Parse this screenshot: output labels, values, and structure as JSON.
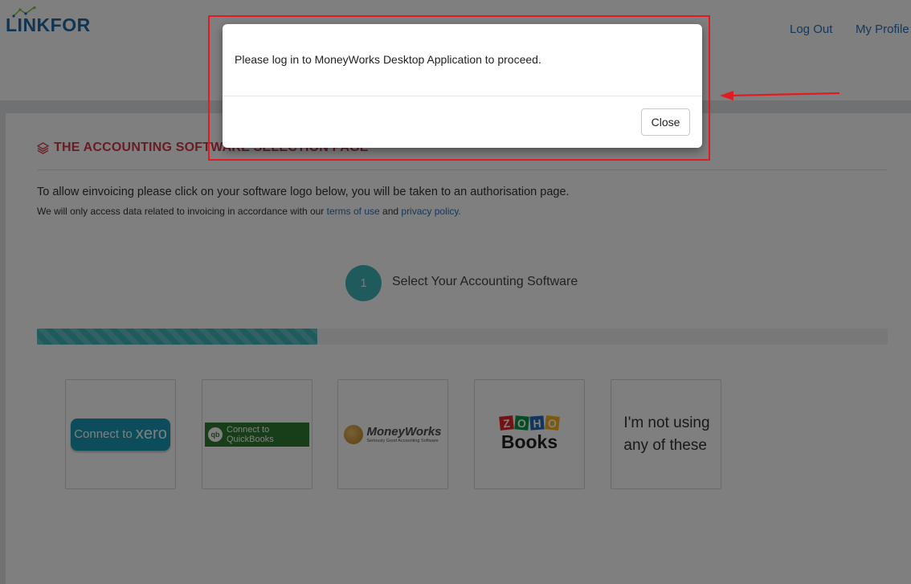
{
  "header": {
    "logo_text": "LINKFOR",
    "nav": {
      "logout": "Log Out",
      "profile": "My Profile"
    }
  },
  "page": {
    "title": "THE ACCOUNTING SOFTWARE SELECTION PAGE",
    "intro": "To allow einvoicing please click on your software logo below, you will be taken to an authorisation page.",
    "note_prefix": "We will only access data related to invoicing in accordance with our",
    "terms_link": "terms of use",
    "note_and": "and",
    "privacy_link": "privacy policy.",
    "step": {
      "number": "1",
      "label": "Select Your Accounting Software"
    },
    "progress_fraction": 0.33
  },
  "tiles": {
    "xero": {
      "prefix": "Connect to",
      "brand": "xero"
    },
    "quickbooks": {
      "badge": "qb",
      "label": "Connect to QuickBooks"
    },
    "moneyworks": {
      "name": "MoneyWorks",
      "tagline": "Seriously Good Accounting Software"
    },
    "zoho": {
      "letters": [
        "Z",
        "O",
        "H",
        "O"
      ],
      "books": "Books"
    },
    "none": {
      "line1": "I'm not using",
      "line2": "any of these"
    }
  },
  "modal": {
    "message": "Please log in to MoneyWorks Desktop Application to proceed.",
    "close_label": "Close"
  },
  "colors": {
    "accent": "#3eb5b9",
    "heading": "#d03a4a",
    "link": "#2672b8",
    "annotation": "#e01b22"
  },
  "icons": {
    "heading_icon": "layers-icon"
  }
}
